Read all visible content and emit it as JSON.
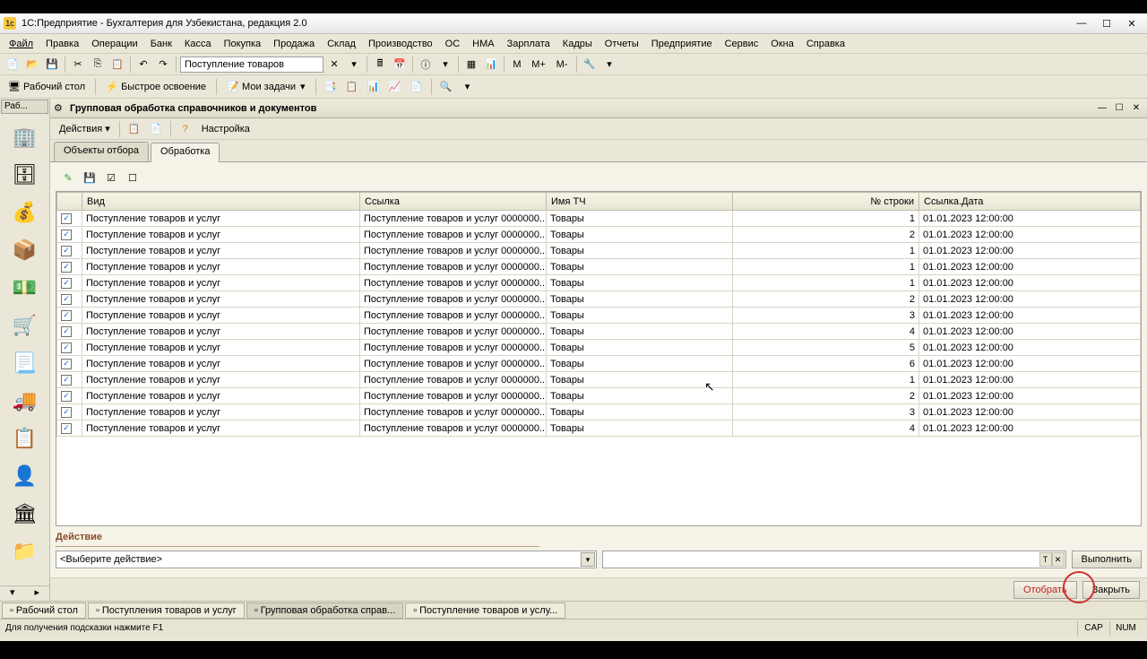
{
  "window": {
    "title": "1С:Предприятие - Бухгалтерия для Узбекистана, редакция 2.0"
  },
  "menu": [
    "Файл",
    "Правка",
    "Операции",
    "Банк",
    "Касса",
    "Покупка",
    "Продажа",
    "Склад",
    "Производство",
    "ОС",
    "НМА",
    "Зарплата",
    "Кадры",
    "Отчеты",
    "Предприятие",
    "Сервис",
    "Окна",
    "Справка"
  ],
  "toolbar": {
    "combo_value": "Поступление товаров",
    "m_labels": [
      "М",
      "М+",
      "М-"
    ]
  },
  "nav": {
    "desktop": "Рабочий стол",
    "quick": "Быстрое освоение",
    "tasks": "Мои задачи"
  },
  "sidebar_tab": "Раб...",
  "doc": {
    "title": "Групповая обработка справочников и документов",
    "actions_btn": "Действия",
    "settings": "Настройка",
    "tabs": [
      "Объекты отбора",
      "Обработка"
    ],
    "active_tab": 1
  },
  "table": {
    "headers": [
      "",
      "Вид",
      "Ссылка",
      "Имя ТЧ",
      "№ строки",
      "Ссылка.Дата"
    ],
    "rows": [
      {
        "chk": true,
        "vid": "Поступление товаров и услуг",
        "link": "Поступление товаров и услуг 0000000...",
        "tch": "Товары",
        "n": 1,
        "date": "01.01.2023 12:00:00"
      },
      {
        "chk": true,
        "vid": "Поступление товаров и услуг",
        "link": "Поступление товаров и услуг 0000000...",
        "tch": "Товары",
        "n": 2,
        "date": "01.01.2023 12:00:00"
      },
      {
        "chk": true,
        "vid": "Поступление товаров и услуг",
        "link": "Поступление товаров и услуг 0000000...",
        "tch": "Товары",
        "n": 1,
        "date": "01.01.2023 12:00:00"
      },
      {
        "chk": true,
        "vid": "Поступление товаров и услуг",
        "link": "Поступление товаров и услуг 0000000...",
        "tch": "Товары",
        "n": 1,
        "date": "01.01.2023 12:00:00"
      },
      {
        "chk": true,
        "vid": "Поступление товаров и услуг",
        "link": "Поступление товаров и услуг 0000000...",
        "tch": "Товары",
        "n": 1,
        "date": "01.01.2023 12:00:00"
      },
      {
        "chk": true,
        "vid": "Поступление товаров и услуг",
        "link": "Поступление товаров и услуг 0000000...",
        "tch": "Товары",
        "n": 2,
        "date": "01.01.2023 12:00:00"
      },
      {
        "chk": true,
        "vid": "Поступление товаров и услуг",
        "link": "Поступление товаров и услуг 0000000...",
        "tch": "Товары",
        "n": 3,
        "date": "01.01.2023 12:00:00"
      },
      {
        "chk": true,
        "vid": "Поступление товаров и услуг",
        "link": "Поступление товаров и услуг 0000000...",
        "tch": "Товары",
        "n": 4,
        "date": "01.01.2023 12:00:00"
      },
      {
        "chk": true,
        "vid": "Поступление товаров и услуг",
        "link": "Поступление товаров и услуг 0000000...",
        "tch": "Товары",
        "n": 5,
        "date": "01.01.2023 12:00:00"
      },
      {
        "chk": true,
        "vid": "Поступление товаров и услуг",
        "link": "Поступление товаров и услуг 0000000...",
        "tch": "Товары",
        "n": 6,
        "date": "01.01.2023 12:00:00"
      },
      {
        "chk": true,
        "vid": "Поступление товаров и услуг",
        "link": "Поступление товаров и услуг 0000000...",
        "tch": "Товары",
        "n": 1,
        "date": "01.01.2023 12:00:00"
      },
      {
        "chk": true,
        "vid": "Поступление товаров и услуг",
        "link": "Поступление товаров и услуг 0000000...",
        "tch": "Товары",
        "n": 2,
        "date": "01.01.2023 12:00:00"
      },
      {
        "chk": true,
        "vid": "Поступление товаров и услуг",
        "link": "Поступление товаров и услуг 0000000...",
        "tch": "Товары",
        "n": 3,
        "date": "01.01.2023 12:00:00"
      },
      {
        "chk": true,
        "vid": "Поступление товаров и услуг",
        "link": "Поступление товаров и услуг 0000000...",
        "tch": "Товары",
        "n": 4,
        "date": "01.01.2023 12:00:00"
      }
    ]
  },
  "action": {
    "label": "Действие",
    "placeholder": "<Выберите действие>",
    "execute": "Выполнить"
  },
  "footer": {
    "select": "Отобрать",
    "close": "Закрыть"
  },
  "taskbar": [
    "Рабочий стол",
    "Поступления товаров и услуг",
    "Групповая обработка справ...",
    "Поступление товаров и услу..."
  ],
  "taskbar_active": 2,
  "statusbar": {
    "text": "Для получения подсказки нажмите F1",
    "cap": "CAP",
    "num": "NUM"
  }
}
